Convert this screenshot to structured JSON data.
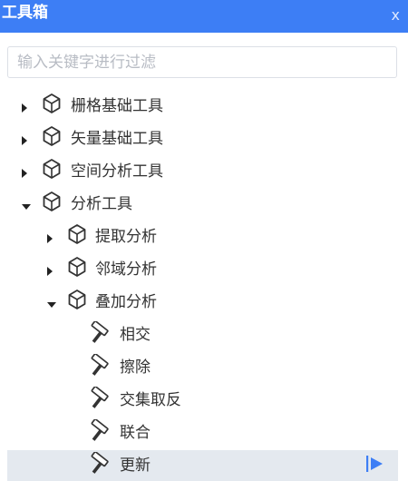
{
  "panel": {
    "title": "工具箱",
    "close_label": "x",
    "accent_color": "#3d7ef5"
  },
  "search": {
    "value": "",
    "placeholder": "输入关键字进行过滤"
  },
  "tree": {
    "items": [
      {
        "label": "栅格基础工具",
        "level": 0,
        "kind": "group",
        "expanded": false,
        "icon": "cube-icon"
      },
      {
        "label": "矢量基础工具",
        "level": 0,
        "kind": "group",
        "expanded": false,
        "icon": "cube-icon"
      },
      {
        "label": "空间分析工具",
        "level": 0,
        "kind": "group",
        "expanded": false,
        "icon": "cube-icon"
      },
      {
        "label": "分析工具",
        "level": 0,
        "kind": "group",
        "expanded": true,
        "icon": "cube-icon"
      },
      {
        "label": "提取分析",
        "level": 1,
        "kind": "group",
        "expanded": false,
        "icon": "cube-icon"
      },
      {
        "label": "邻域分析",
        "level": 1,
        "kind": "group",
        "expanded": false,
        "icon": "cube-icon"
      },
      {
        "label": "叠加分析",
        "level": 1,
        "kind": "group",
        "expanded": true,
        "icon": "cube-icon"
      },
      {
        "label": "相交",
        "level": 2,
        "kind": "tool",
        "icon": "hammer-icon"
      },
      {
        "label": "擦除",
        "level": 2,
        "kind": "tool",
        "icon": "hammer-icon"
      },
      {
        "label": "交集取反",
        "level": 2,
        "kind": "tool",
        "icon": "hammer-icon"
      },
      {
        "label": "联合",
        "level": 2,
        "kind": "tool",
        "icon": "hammer-icon"
      },
      {
        "label": "更新",
        "level": 2,
        "kind": "tool",
        "icon": "hammer-icon",
        "selected": true,
        "run_icon": "run-icon"
      }
    ]
  }
}
